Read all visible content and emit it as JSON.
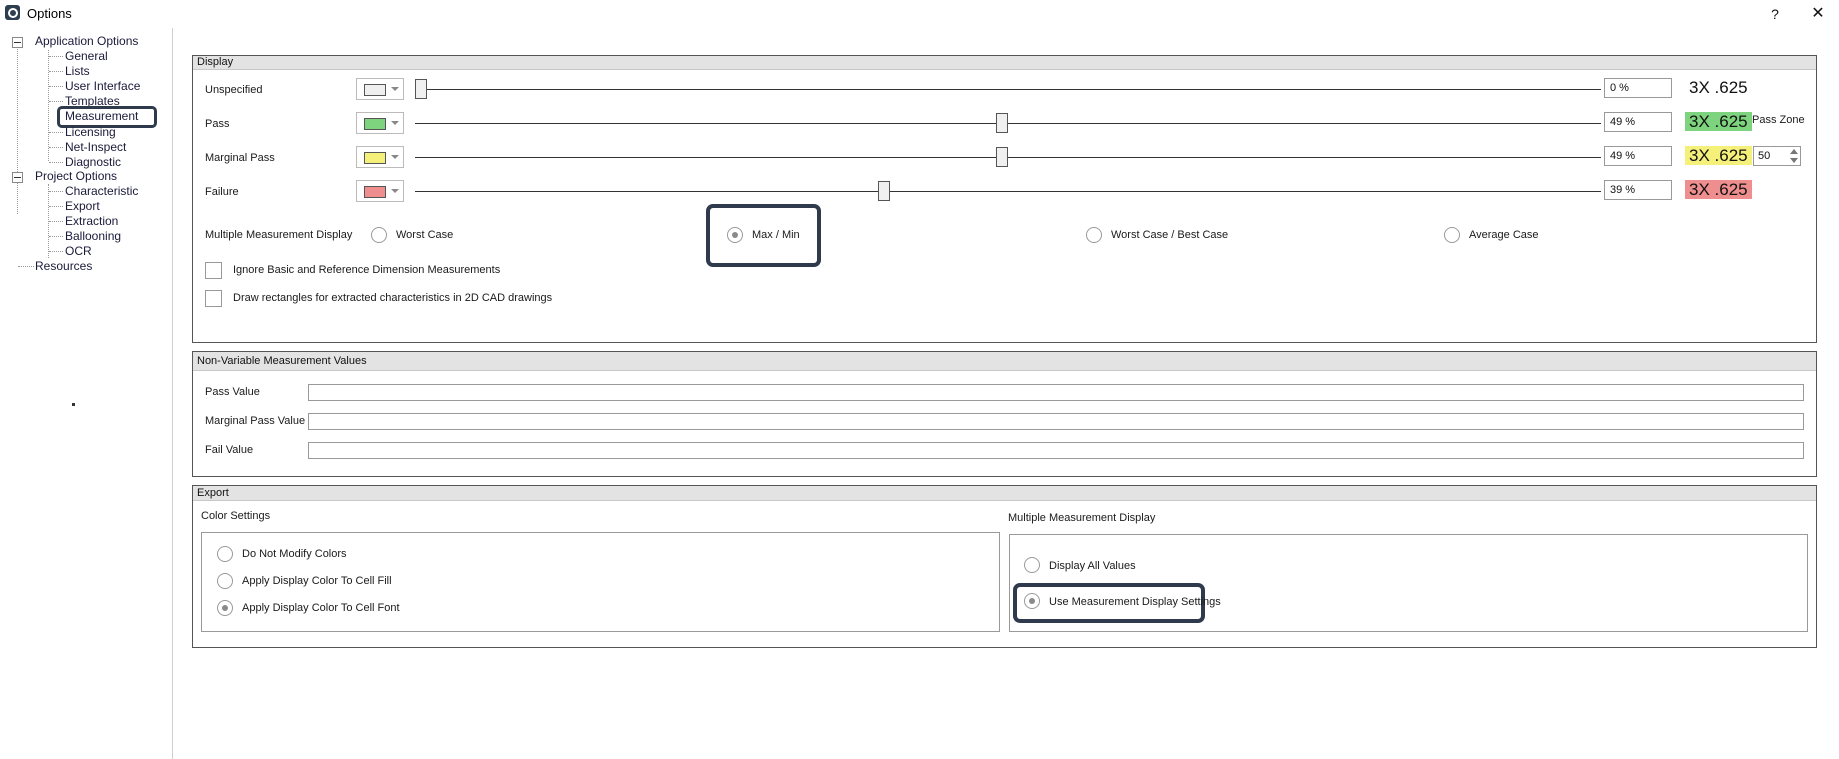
{
  "window": {
    "title": "Options",
    "help_label": "?",
    "close_label": "✕"
  },
  "tree": {
    "application_options": "Application Options",
    "application_children": [
      "General",
      "Lists",
      "User Interface",
      "Templates",
      "Measurement",
      "Licensing",
      "Net-Inspect",
      "Diagnostic"
    ],
    "project_options": "Project Options",
    "project_children": [
      "Characteristic",
      "Export",
      "Extraction",
      "Ballooning",
      "OCR"
    ],
    "resources": "Resources",
    "selected": "Measurement"
  },
  "display": {
    "title": "Display",
    "rows": [
      {
        "label": "Unspecified",
        "color": "#efefef",
        "percent": 0,
        "percent_text": "0 %",
        "sample": "3X .625",
        "sample_bg": "#ffffff"
      },
      {
        "label": "Pass",
        "color": "#7ed47e",
        "percent": 49,
        "percent_text": "49 %",
        "sample": "3X .625",
        "sample_bg": "#7ed47e"
      },
      {
        "label": "Marginal Pass",
        "color": "#f5f07a",
        "percent": 49,
        "percent_text": "49 %",
        "sample": "3X .625",
        "sample_bg": "#f5f07a"
      },
      {
        "label": "Failure",
        "color": "#ee8e8e",
        "percent": 39,
        "percent_text": "39 %",
        "sample": "3X .625",
        "sample_bg": "#ee8e8e"
      }
    ],
    "pass_zone_label": "Pass Zone",
    "pass_zone_value": "50",
    "multiple_measurement_label": "Multiple Measurement Display",
    "options": [
      "Worst Case",
      "Max / Min",
      "Worst Case / Best Case",
      "Average Case"
    ],
    "selected_option": "Max / Min",
    "checkbox_ignore": "Ignore Basic and Reference Dimension Measurements",
    "checkbox_draw": "Draw rectangles for extracted characteristics in 2D CAD drawings"
  },
  "non_variable": {
    "title": "Non-Variable Measurement Values",
    "fields": [
      {
        "label": "Pass Value",
        "value": ""
      },
      {
        "label": "Marginal Pass Value",
        "value": ""
      },
      {
        "label": "Fail Value",
        "value": ""
      }
    ]
  },
  "export": {
    "title": "Export",
    "color_settings_label": "Color Settings",
    "color_options": [
      "Do Not Modify Colors",
      "Apply Display Color To Cell Fill",
      "Apply Display Color To Cell Font"
    ],
    "color_selected": "Apply Display Color To Cell Font",
    "multiple_label": "Multiple Measurement Display",
    "multiple_options": [
      "Display All Values",
      "Use Measurement Display Settings"
    ],
    "multiple_selected": "Use Measurement Display Settings"
  }
}
